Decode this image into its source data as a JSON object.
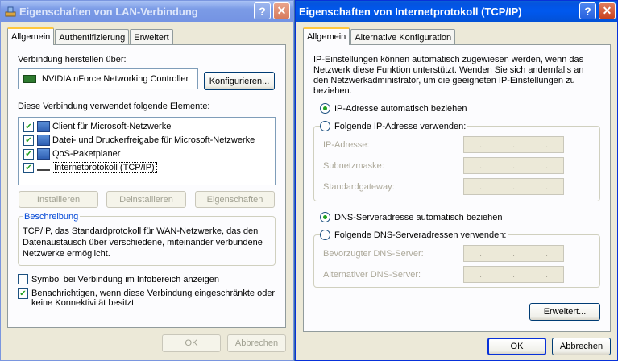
{
  "left_window": {
    "title": "Eigenschaften von LAN-Verbindung",
    "tabs": [
      "Allgemein",
      "Authentifizierung",
      "Erweitert"
    ],
    "connect_using_label": "Verbindung herstellen über:",
    "adapter_name": "NVIDIA nForce Networking Controller",
    "configure_button": "Konfigurieren...",
    "components_label": "Diese Verbindung verwendet folgende Elemente:",
    "components": [
      {
        "label": "Client für Microsoft-Netzwerke",
        "checked": true
      },
      {
        "label": "Datei- und Druckerfreigabe für Microsoft-Netzwerke",
        "checked": true
      },
      {
        "label": "QoS-Paketplaner",
        "checked": true
      },
      {
        "label": "Internetprotokoll (TCP/IP)",
        "checked": true
      }
    ],
    "install_button": "Installieren",
    "uninstall_button": "Deinstallieren",
    "properties_button": "Eigenschaften",
    "description_title": "Beschreibung",
    "description_text_1": "TCP/IP, das Standardprotokoll für WAN-Netzwerke, das den",
    "description_text_2": "Datenaustausch über verschiedene, miteinander verbundene",
    "description_text_3": "Netzwerke ermöglicht.",
    "show_icon_label": "Symbol bei Verbindung im Infobereich anzeigen",
    "notify_label_1": "Benachrichtigen, wenn diese Verbindung eingeschränkte oder",
    "notify_label_2": "keine Konnektivität besitzt",
    "ok_button": "OK",
    "cancel_button": "Abbrechen"
  },
  "right_window": {
    "title": "Eigenschaften von Internetprotokoll (TCP/IP)",
    "tabs": [
      "Allgemein",
      "Alternative Konfiguration"
    ],
    "intro_1": "IP-Einstellungen können automatisch zugewiesen werden, wenn das",
    "intro_2": "Netzwerk diese Funktion unterstützt. Wenden Sie sich andernfalls an",
    "intro_3": "den Netzwerkadministrator, um die geeigneten IP-Einstellungen zu",
    "intro_4": "beziehen.",
    "ip_auto_label": "IP-Adresse automatisch beziehen",
    "ip_manual_label": "Folgende IP-Adresse verwenden:",
    "ip_address_label": "IP-Adresse:",
    "subnet_label": "Subnetzmaske:",
    "gateway_label": "Standardgateway:",
    "dns_auto_label": "DNS-Serveradresse automatisch beziehen",
    "dns_manual_label": "Folgende DNS-Serveradressen verwenden:",
    "preferred_dns_label": "Bevorzugter DNS-Server:",
    "alternate_dns_label": "Alternativer DNS-Server:",
    "advanced_button": "Erweitert...",
    "ok_button": "OK",
    "cancel_button": "Abbrechen"
  },
  "ip_dot": "."
}
